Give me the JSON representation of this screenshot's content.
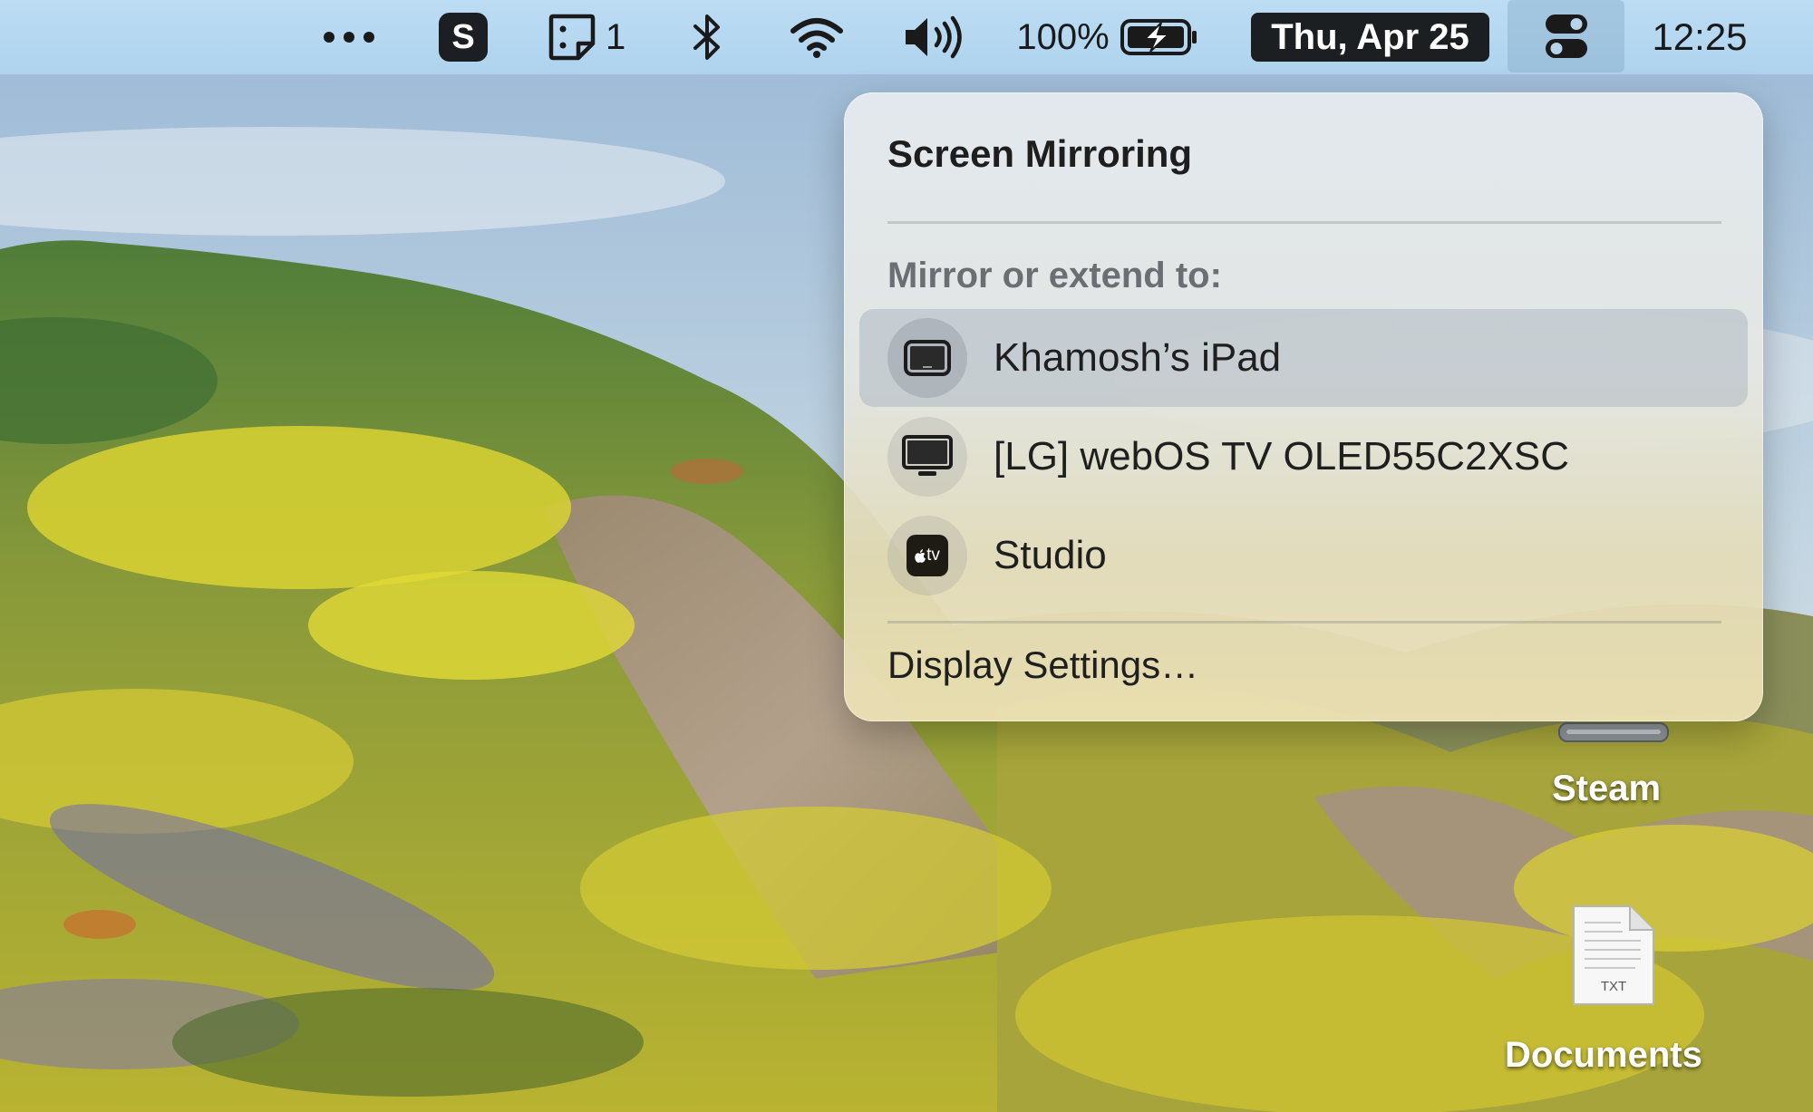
{
  "menubar": {
    "more_icon": "ellipsis-icon",
    "skype_letter": "S",
    "stickies_count": "1",
    "bluetooth_icon": "bluetooth-icon",
    "wifi_icon": "wifi-icon",
    "volume_icon": "volume-icon",
    "battery_percent": "100%",
    "battery_icon": "battery-charging-icon",
    "date": "Thu, Apr 25",
    "control_center_icon": "control-center-icon",
    "time": "12:25"
  },
  "screen_mirroring": {
    "title": "Screen Mirroring",
    "section_label": "Mirror or extend to:",
    "devices": [
      {
        "label": "Khamosh’s iPad",
        "icon": "ipad-icon",
        "selected": true
      },
      {
        "label": "[LG] webOS TV OLED55C2XSC",
        "icon": "tv-icon",
        "selected": false
      },
      {
        "label": "Studio",
        "icon": "appletv-icon",
        "icon_text": "tv",
        "selected": false
      }
    ],
    "display_settings": "Display Settings…"
  },
  "desktop": {
    "icons": [
      {
        "label": "Steam",
        "icon": "drive-icon"
      },
      {
        "label": "Documents",
        "icon": "txt-file-icon",
        "file_tag": "TXT"
      }
    ]
  },
  "colors": {
    "menubar_bg": "#b5d7f0",
    "date_bg": "#1c1f22",
    "panel_bg": "#e6e8e6",
    "selected_row": "#a0acba"
  }
}
